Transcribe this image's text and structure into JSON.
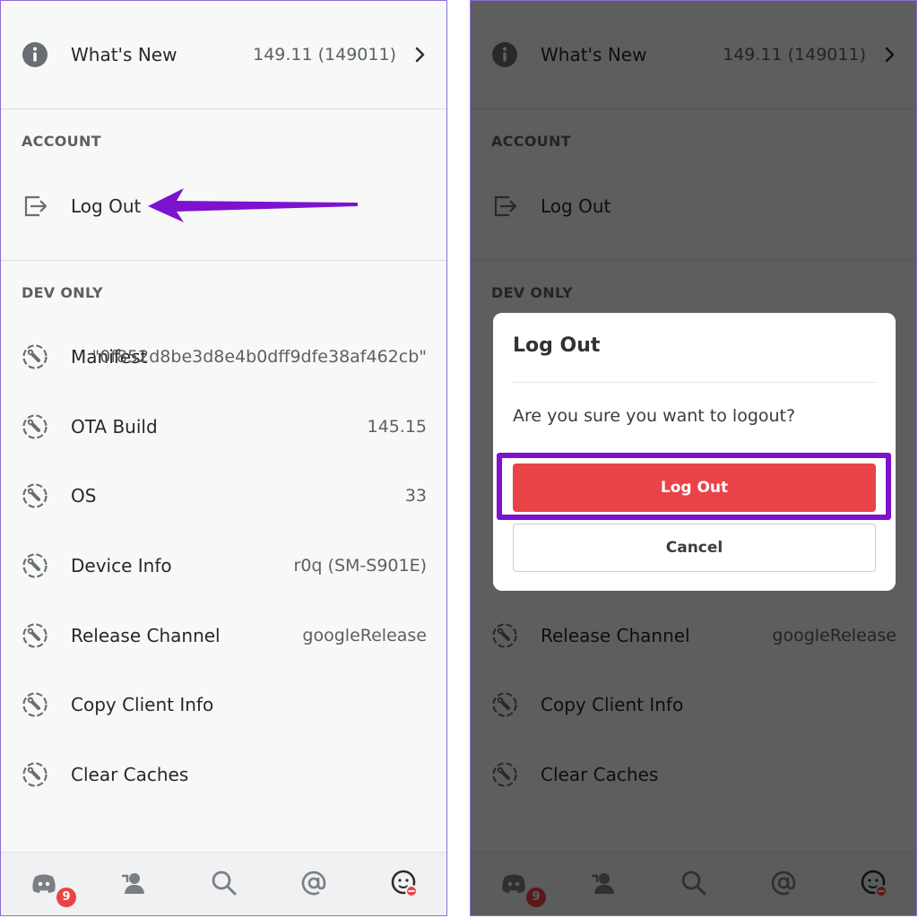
{
  "accent_arrow_color": "#7d12cf",
  "danger_color": "#ea4347",
  "whats_new": {
    "label": "What's New",
    "value": "149.11 (149011)",
    "icon": "info-icon"
  },
  "account_section": {
    "heading": "ACCOUNT",
    "logout_label": "Log Out",
    "icon": "logout-icon"
  },
  "dev_section": {
    "heading": "DEV ONLY",
    "manifest": {
      "label": "Manifest",
      "value": "\"0f852d8be3d8e4b0dff9dfe38af462cb\""
    },
    "ota": {
      "label": "OTA Build",
      "value": "145.15"
    },
    "os": {
      "label": "OS",
      "value": "33"
    },
    "device": {
      "label": "Device Info",
      "value": "r0q (SM-S901E)"
    },
    "channel": {
      "label": "Release Channel",
      "value": "googleRelease"
    },
    "copy": {
      "label": "Copy Client Info"
    },
    "clear": {
      "label": "Clear Caches"
    }
  },
  "nav": {
    "badge": "9"
  },
  "dialog": {
    "title": "Log Out",
    "message": "Are you sure you want to logout?",
    "confirm": "Log Out",
    "cancel": "Cancel"
  }
}
